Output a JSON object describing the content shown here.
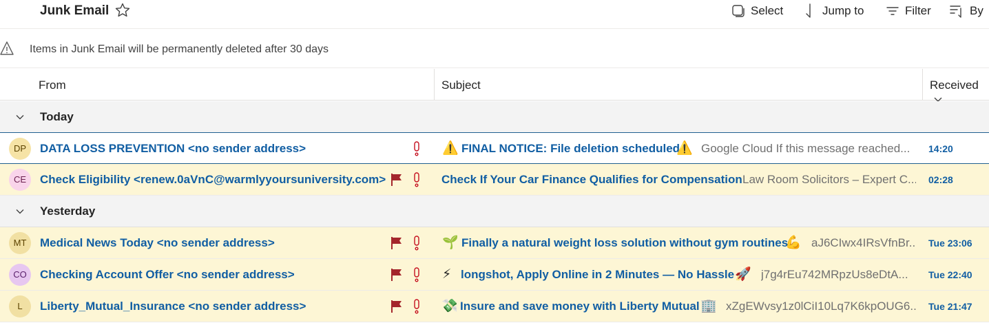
{
  "toolbar": {
    "folder_title": "Junk Email",
    "select_label": "Select",
    "jump_label": "Jump to",
    "filter_label": "Filter",
    "sort_label": "By"
  },
  "notice": {
    "text": "Items in Junk Email will be permanently deleted after 30 days"
  },
  "columns": {
    "from": "From",
    "subject": "Subject",
    "received": "Received"
  },
  "groups": [
    {
      "label": "Today"
    },
    {
      "label": "Yesterday"
    }
  ],
  "messages": [
    {
      "initials": "DP",
      "sender": "DATA LOSS PREVENTION <no sender address>",
      "subject_prefix_icon": "⚠️",
      "subject": "FINAL NOTICE: File deletion scheduled",
      "subject_suffix_icon": "⚠️",
      "preview": "Google Cloud If this message reached...",
      "received": "14:20",
      "flagged": false,
      "avatar_bg": "#f6e3a6",
      "avatar_fg": "#5c4300"
    },
    {
      "initials": "CE",
      "sender": "Check Eligibility <renew.0aVnC@warmlyyoursuniversity.com>",
      "subject_prefix_icon": "",
      "subject": "Check If Your Car Finance Qualifies for Compensation",
      "subject_suffix_icon": "",
      "preview": "Law Room Solicitors – Expert C...",
      "received": "02:28",
      "flagged": true,
      "avatar_bg": "#f9d4ea",
      "avatar_fg": "#6b1f4f"
    },
    {
      "initials": "MT",
      "sender": "Medical News Today <no sender address>",
      "subject_prefix_icon": "🌱",
      "subject": "Finally a natural weight loss solution without gym routines",
      "subject_suffix_icon": "💪",
      "preview": "aJ6CIwx4IRsVfnBr...",
      "received": "Tue 23:06",
      "flagged": true,
      "avatar_bg": "#f1e0a3",
      "avatar_fg": "#5c4300"
    },
    {
      "initials": "CO",
      "sender": "Checking Account Offer <no sender address>",
      "subject_prefix_icon": "⚡",
      "subject": "longshot, Apply Online in 2 Minutes — No Hassle",
      "subject_suffix_icon": "🚀",
      "preview": "j7g4rEu742MRpzUs8eDtA...",
      "received": "Tue 22:40",
      "flagged": true,
      "avatar_bg": "#e7c7f0",
      "avatar_fg": "#5a1f6b"
    },
    {
      "initials": "L",
      "sender": "Liberty_Mutual_Insurance <no sender address>",
      "subject_prefix_icon": "💸",
      "subject": "Insure and save money with Liberty Mutual",
      "subject_suffix_icon": "🏢",
      "preview": "xZgEWvsy1z0lCiI10Lq7K6kpOUG6...",
      "received": "Tue 21:47",
      "flagged": true,
      "avatar_bg": "#f1e0a3",
      "avatar_fg": "#5c4300"
    }
  ],
  "colors": {
    "accent": "#115ea3",
    "flag": "#c50f1f",
    "flagged_row": "#fdf6d5"
  }
}
